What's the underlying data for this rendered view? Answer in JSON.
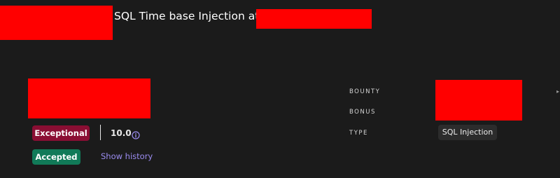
{
  "header": {
    "title": "SQL Time base Injection at"
  },
  "report": {
    "severity_label": "Exceptional",
    "score": "10.0",
    "status_label": "Accepted",
    "history_link": "Show history"
  },
  "details": {
    "bounty_label": "BOUNTY",
    "bonus_label": "BONUS",
    "type_label": "TYPE",
    "type_value": "SQL Injection"
  },
  "icons": {
    "info": "info-circle-icon",
    "edge": "chevron-right-icon"
  },
  "colors": {
    "redaction": "#ff0000",
    "severity_badge": "#8a0e33",
    "status_badge": "#117a58",
    "link": "#9b8cf0",
    "background": "#1b1b1b"
  }
}
